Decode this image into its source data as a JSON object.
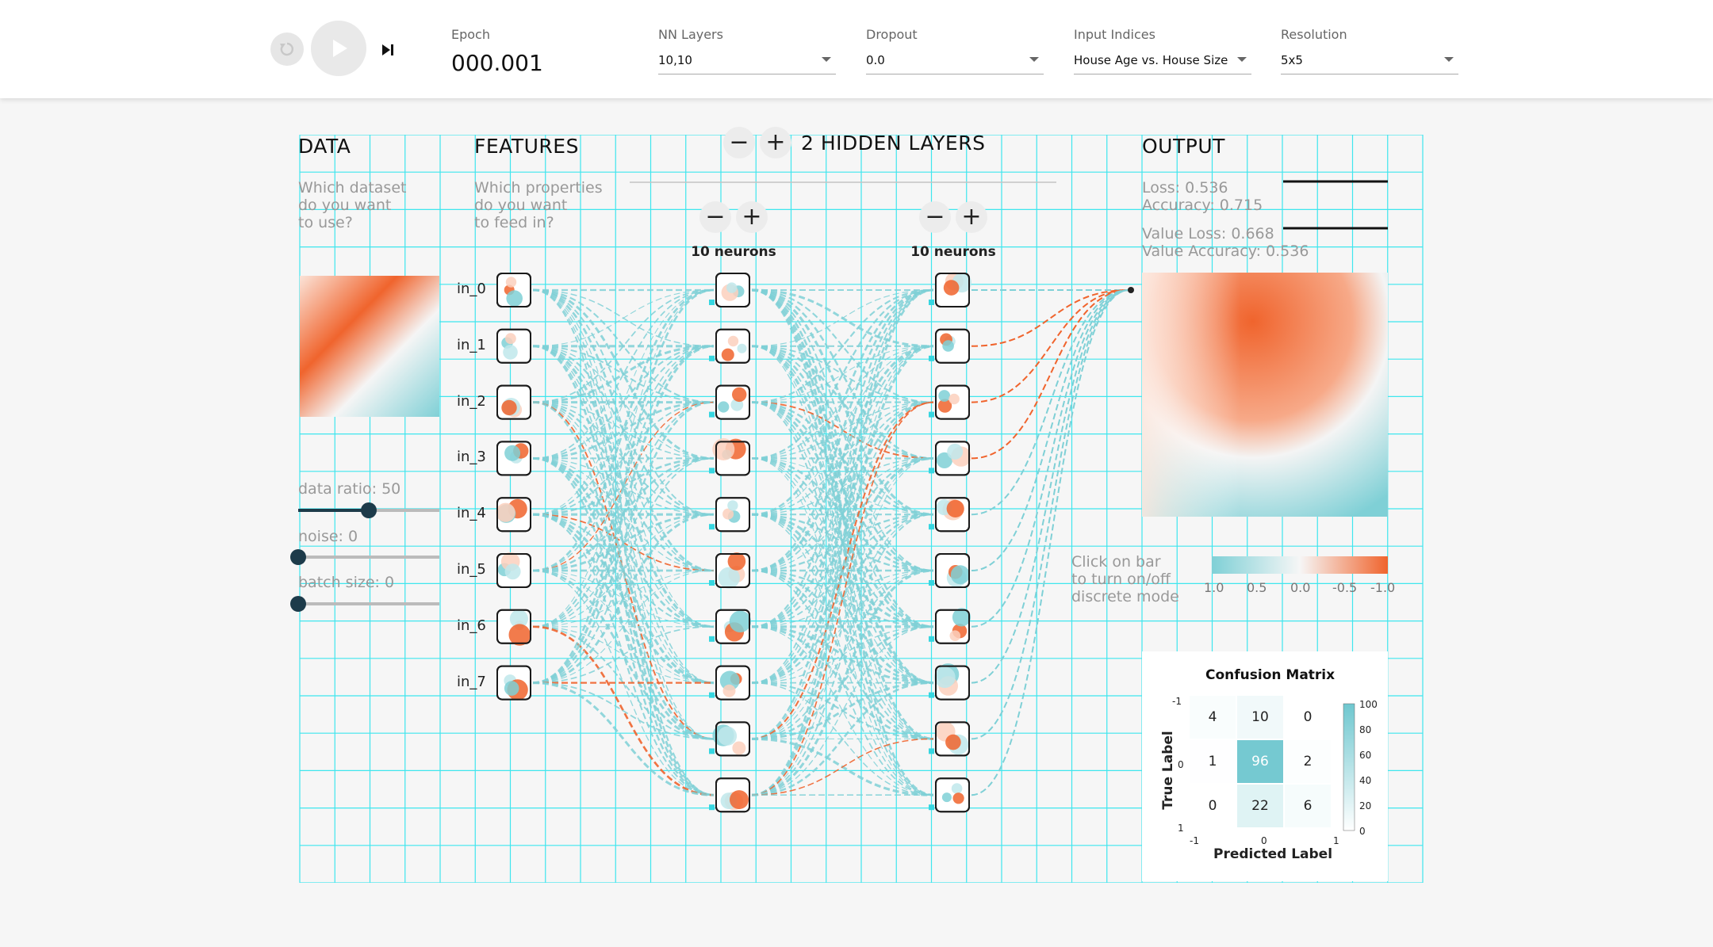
{
  "topbar": {
    "epoch_label": "Epoch",
    "epoch_value": "000.001",
    "nn_layers": {
      "label": "NN Layers",
      "value": "10,10"
    },
    "dropout": {
      "label": "Dropout",
      "value": "0.0"
    },
    "input_indices": {
      "label": "Input Indices",
      "value": "House Age vs. House Size"
    },
    "resolution": {
      "label": "Resolution",
      "value": "5x5"
    }
  },
  "data_panel": {
    "heading": "DATA",
    "subtext": [
      "Which dataset",
      "do you want",
      "to use?"
    ],
    "data_ratio": {
      "label": "data ratio: 50",
      "value": 0.5
    },
    "noise": {
      "label": "noise: 0",
      "value": 0
    },
    "batch_size": {
      "label": "batch size: 0",
      "value": 0
    }
  },
  "features_panel": {
    "heading": "FEATURES",
    "subtext": [
      "Which properties",
      "do you want",
      "to feed in?"
    ],
    "inputs": [
      "in_0",
      "in_1",
      "in_2",
      "in_3",
      "in_4",
      "in_5",
      "in_6",
      "in_7"
    ]
  },
  "hidden": {
    "heading": "2 HIDDEN LAYERS",
    "minus": "−",
    "plus": "+",
    "layers": [
      {
        "neurons_label": "10 neurons"
      },
      {
        "neurons_label": "10 neurons"
      }
    ]
  },
  "output_panel": {
    "heading": "OUTPUT",
    "loss": "Loss: 0.536",
    "accuracy": "Accuracy: 0.715",
    "value_loss": "Value Loss: 0.668",
    "value_accuracy": "Value Accuracy: 0.536",
    "discrete_hint": [
      "Click on bar",
      "to turn on/off",
      "discrete mode"
    ],
    "legend_ticks": [
      "1.0",
      "0.5",
      "0.0",
      "-0.5",
      "-1.0"
    ]
  },
  "confusion_matrix": {
    "title": "Confusion Matrix",
    "ylabel": "True Label",
    "xlabel": "Predicted Label",
    "row_ticks": [
      "-1",
      "0",
      "1"
    ],
    "col_ticks": [
      "-1",
      "0",
      "1"
    ],
    "cells": [
      [
        4,
        10,
        0
      ],
      [
        1,
        96,
        2
      ],
      [
        0,
        22,
        6
      ]
    ],
    "colorbar_ticks": [
      "100",
      "80",
      "60",
      "40",
      "20",
      "0"
    ]
  },
  "colors": {
    "accent_orange": "#f0642d",
    "accent_teal": "#7fd0d6",
    "grid_cyan": "#3ee6ee",
    "dark": "#1d3b4a"
  },
  "icons": [
    "reset-icon",
    "play-icon",
    "step-forward-icon"
  ]
}
